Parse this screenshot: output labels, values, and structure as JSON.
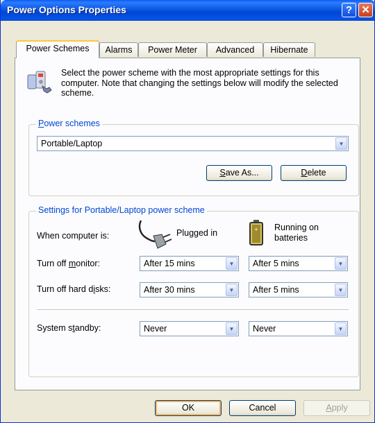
{
  "window": {
    "title": "Power Options Properties"
  },
  "titlebar": {
    "help_glyph": "?",
    "close_glyph": "✕"
  },
  "tabs": [
    {
      "label": "Power Schemes",
      "active": true
    },
    {
      "label": "Alarms"
    },
    {
      "label": "Power Meter"
    },
    {
      "label": "Advanced"
    },
    {
      "label": "Hibernate"
    }
  ],
  "intro": "Select the power scheme with the most appropriate settings for this computer. Note that changing the settings below will modify the selected scheme.",
  "schemes_group": {
    "label_accel": "P",
    "label_rest": "ower schemes",
    "selected": "Portable/Laptop",
    "save_as": {
      "accel": "S",
      "rest": "ave As..."
    },
    "delete": {
      "accel": "D",
      "rest": "elete"
    }
  },
  "settings_group": {
    "label": "Settings for Portable/Laptop power scheme",
    "when_label": "When computer is:",
    "plugged_in": "Plugged in",
    "running_on_batteries": "Running on\nbatteries",
    "rows": [
      {
        "pre": "Turn off ",
        "accel": "m",
        "post": "onitor:",
        "plugged": "After 15 mins",
        "battery": "After 5 mins"
      },
      {
        "pre": "Turn off hard d",
        "accel": "i",
        "post": "sks:",
        "plugged": "After 30 mins",
        "battery": "After 5 mins"
      },
      {
        "pre": "System s",
        "accel": "t",
        "post": "andby:",
        "plugged": "Never",
        "battery": "Never"
      }
    ]
  },
  "footer": {
    "ok": "OK",
    "cancel": "Cancel",
    "apply_accel": "A",
    "apply_rest": "pply"
  },
  "icons": {
    "scheme": "power-scheme-icon",
    "plug": "power-plug-icon",
    "battery": "battery-icon",
    "dropdown": "chevron-down-icon"
  },
  "colors": {
    "title_bar": "#0054e3",
    "window_bg": "#ece9d8",
    "tab_highlight": "#ffc73c",
    "group_label": "#0046d5"
  }
}
